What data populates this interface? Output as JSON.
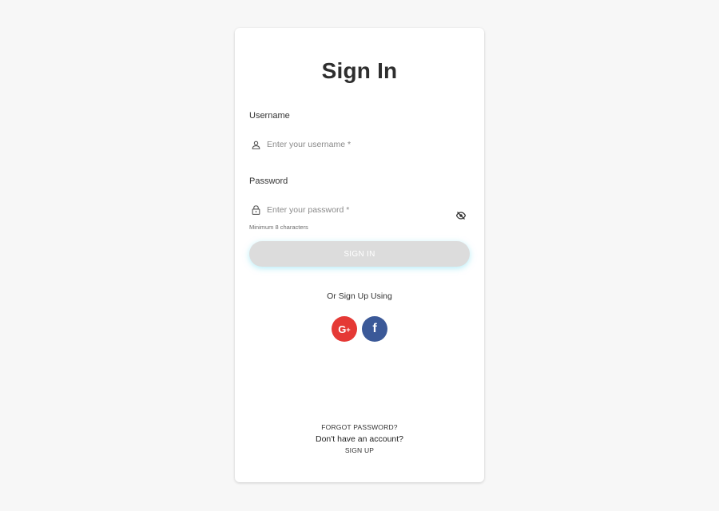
{
  "title": "Sign In",
  "username": {
    "label": "Username",
    "placeholder": "Enter your username *",
    "value": "",
    "icon": "user-icon"
  },
  "password": {
    "label": "Password",
    "placeholder": "Enter your password *",
    "value": "",
    "icon": "lock-icon",
    "toggle_icon": "eye-off-icon",
    "hint": "Minimum 8 characters"
  },
  "sign_in_button": {
    "label": "SIGN IN",
    "state": "disabled"
  },
  "social": {
    "prompt": "Or Sign Up Using",
    "providers": [
      {
        "name": "google",
        "icon": "google-plus-icon",
        "color": "#e53935"
      },
      {
        "name": "facebook",
        "icon": "facebook-icon",
        "color": "#3b5998"
      }
    ]
  },
  "footer": {
    "forgot_password": "FORGOT PASSWORD?",
    "no_account": "Don't have an account?",
    "sign_up": "SIGN UP"
  },
  "colors": {
    "page_background": "#f7f7f7",
    "card_background": "#ffffff",
    "button_disabled": "#dcdcdc",
    "button_glow": "#78dcf0"
  }
}
